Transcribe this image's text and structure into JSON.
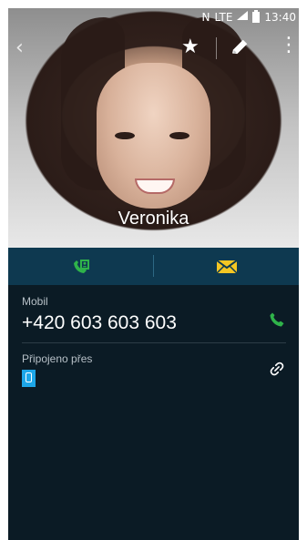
{
  "status_bar": {
    "network_badge": "N",
    "network_type": "LTE",
    "time": "13:40"
  },
  "contact": {
    "name": "Veronika"
  },
  "header_actions": {
    "back_icon": "back-chevron-icon",
    "favorite_icon": "star-icon",
    "edit_icon": "pencil-icon",
    "menu_icon": "more-vert-icon"
  },
  "quick_actions": {
    "left_icon": "contact-call-icon",
    "right_icon": "envelope-icon"
  },
  "details": {
    "phone_label": "Mobil",
    "phone_number": "+420 603 603 603",
    "connected_label": "Připojeno přes"
  },
  "colors": {
    "green": "#2fb34a",
    "yellow": "#f4c623",
    "dark_background": "#0b1b25",
    "action_bar": "#0e3950"
  }
}
